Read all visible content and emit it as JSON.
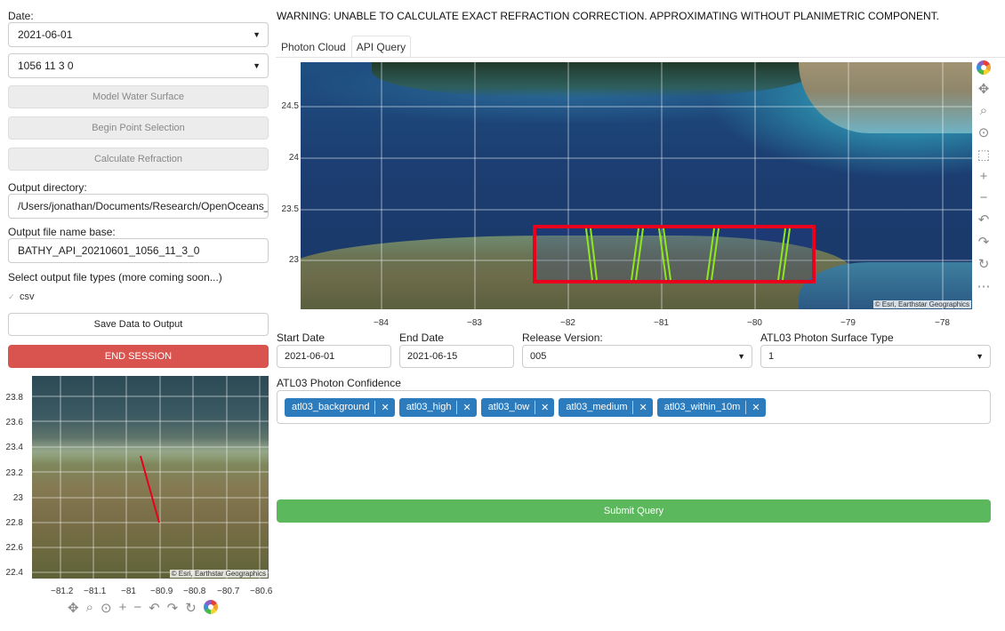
{
  "sidebar": {
    "date_label": "Date:",
    "date_value": "2021-06-01",
    "track_value": "1056 11 3 0",
    "model_water_btn": "Model Water Surface",
    "begin_point_btn": "Begin Point Selection",
    "calc_refraction_btn": "Calculate Refraction",
    "output_dir_label": "Output directory:",
    "output_dir_value": "/Users/jonathan/Documents/Research/OpenOceans_P",
    "output_base_label": "Output file name base:",
    "output_base_value": "BATHY_API_20210601_1056_11_3_0",
    "file_types_label": "Select output file types (more coming soon...)",
    "csv_label": "csv",
    "save_btn": "Save Data to Output",
    "end_btn": "END SESSION"
  },
  "mini_map": {
    "y_ticks": [
      "23.8",
      "23.6",
      "23.4",
      "23.2",
      "23",
      "22.8",
      "22.6",
      "22.4"
    ],
    "x_ticks": [
      "−81.2",
      "−81.1",
      "−81",
      "−80.9",
      "−80.8",
      "−80.7",
      "−80.6"
    ],
    "attribution": "© Esri, Earthstar Geographics"
  },
  "warning": "WARNING: UNABLE TO CALCULATE EXACT REFRACTION CORRECTION. APPROXIMATING WITHOUT PLANIMETRIC COMPONENT.",
  "tabs": [
    "Photon Cloud",
    "API Query"
  ],
  "main_map": {
    "y_ticks": [
      "24.5",
      "24",
      "23.5",
      "23"
    ],
    "x_ticks": [
      "−84",
      "−83",
      "−82",
      "−81",
      "−80",
      "−79",
      "−78"
    ],
    "attribution": "© Esri, Earthstar Geographics",
    "bbox_color": "#e8001c",
    "track_color": "#8fe81c"
  },
  "query": {
    "start_label": "Start Date",
    "start_value": "2021-06-01",
    "end_label": "End Date",
    "end_value": "2021-06-15",
    "release_label": "Release Version:",
    "release_value": "005",
    "surface_label": "ATL03 Photon Surface Type",
    "surface_value": "1",
    "confidence_label": "ATL03 Photon Confidence",
    "chips": [
      "atl03_background",
      "atl03_high",
      "atl03_low",
      "atl03_medium",
      "atl03_within_10m"
    ],
    "submit_btn": "Submit Query"
  }
}
